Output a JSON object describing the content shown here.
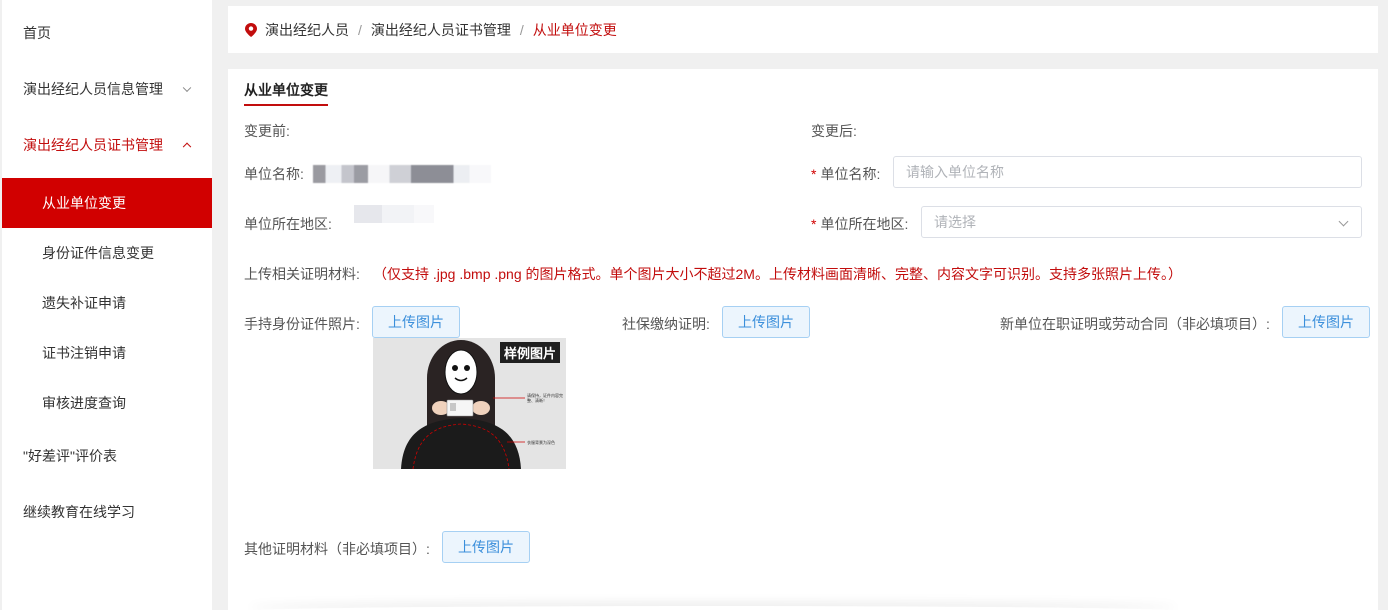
{
  "sidebar": {
    "home": "首页",
    "info_mgmt": "演出经纪人员信息管理",
    "cert_mgmt": "演出经纪人员证书管理",
    "cert_items": [
      "从业单位变更",
      "身份证件信息变更",
      "遗失补证申请",
      "证书注销申请",
      "审核进度查询"
    ],
    "review_form": "\"好差评\"评价表",
    "continuing_edu": "继续教育在线学习"
  },
  "breadcrumb": {
    "items": [
      "演出经纪人员",
      "演出经纪人员证书管理"
    ],
    "separator": "/",
    "current": "从业单位变更"
  },
  "form": {
    "section_title": "从业单位变更",
    "before_label": "变更前:",
    "after_label": "变更后:",
    "unit_name_label": "单位名称:",
    "unit_region_label": "单位所在地区:",
    "required_mark": "*",
    "unit_name_placeholder": "请输入单位名称",
    "region_placeholder": "请选择",
    "materials_label": "上传相关证明材料:",
    "materials_note": "（仅支持 .jpg .bmp .png 的图片格式。单个图片大小不超过2M。上传材料画面清晰、完整、内容文字可识别。支持多张照片上传。）",
    "id_photo_label": "手持身份证件照片:",
    "social_security_label": "社保缴纳证明:",
    "employment_label": "新单位在职证明或劳动合同（非必填项目）:",
    "other_label": "其他证明材料（非必填项目）:",
    "upload_button": "上传图片",
    "sample_tag": "样例图片",
    "sample_notes": [
      "请保持，证件内容完整、清晰！",
      "衣服背景为深色"
    ]
  },
  "colors": {
    "brand_red": "#c20d0d",
    "menu_selected_bg": "#d10000",
    "upload_blue": "#3b8fdb"
  }
}
